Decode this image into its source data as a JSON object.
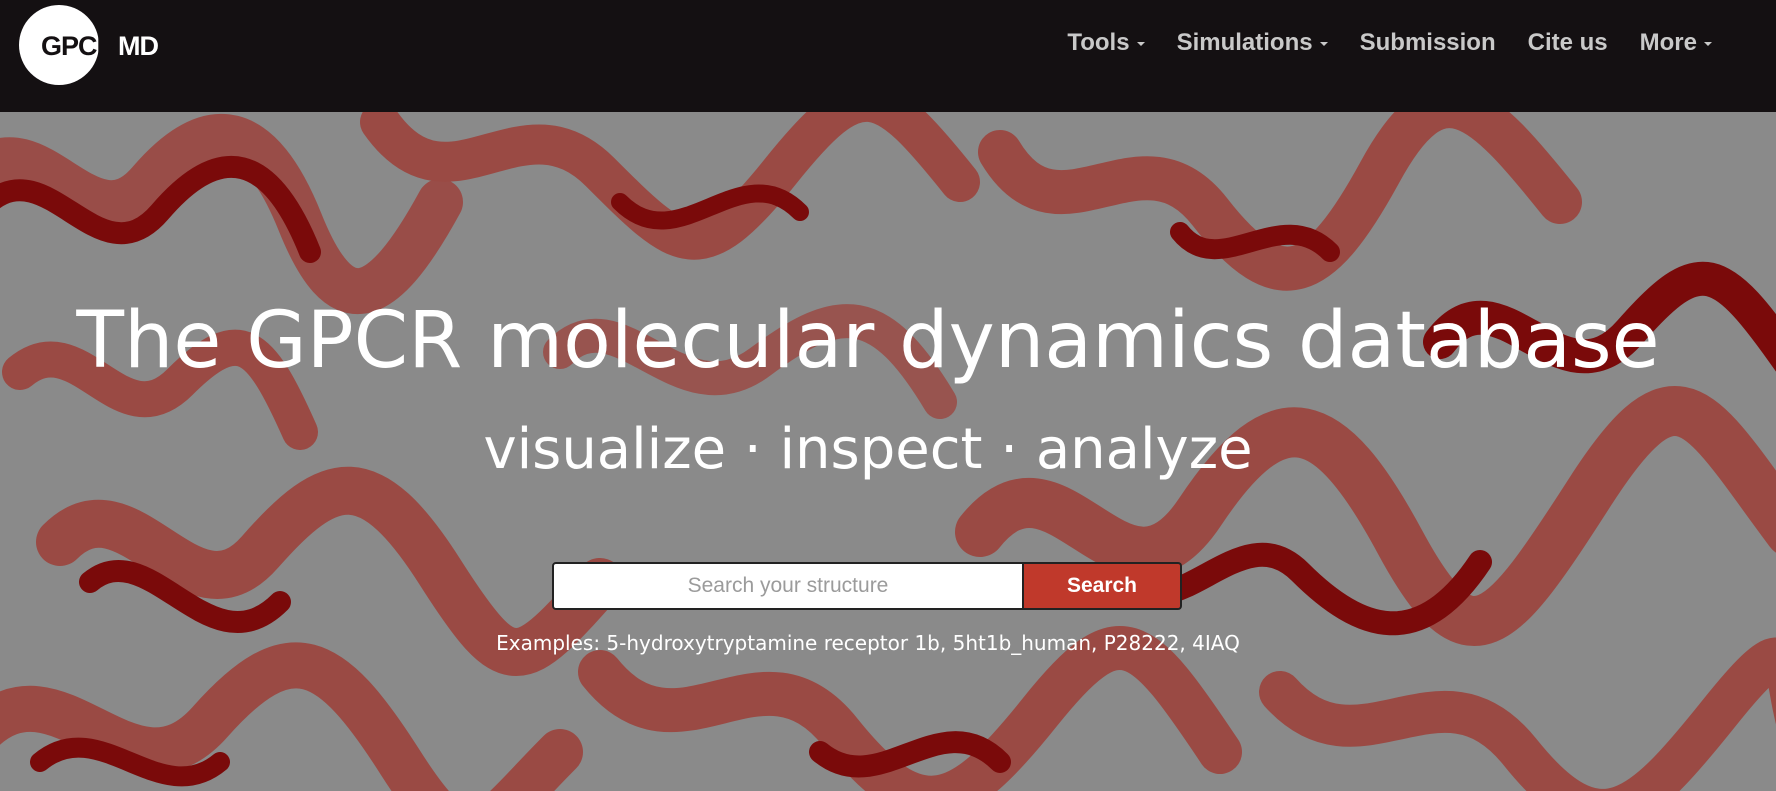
{
  "brand": {
    "logo_left": "GPCR",
    "logo_right": "MD",
    "colors": {
      "navbar_bg": "#141012",
      "nav_text": "#c9c9c9",
      "accent": "#c0392b",
      "hero_bg": "#8a8a8a",
      "helix_dark": "#7a0a0a",
      "helix_light": "#9a4a44"
    }
  },
  "nav": {
    "items": [
      {
        "label": "Tools",
        "dropdown": true
      },
      {
        "label": "Simulations",
        "dropdown": true
      },
      {
        "label": "Submission",
        "dropdown": false
      },
      {
        "label": "Cite us",
        "dropdown": false
      },
      {
        "label": "More",
        "dropdown": true
      }
    ]
  },
  "hero": {
    "title": "The GPCR molecular dynamics database",
    "subtitle": "visualize · inspect · analyze",
    "background": "protein-helix-ribbons-image"
  },
  "search": {
    "placeholder": "Search your structure",
    "value": "",
    "button_label": "Search"
  },
  "examples": {
    "text": "Examples: 5-hydroxytryptamine receptor 1b, 5ht1b_human, P28222, 4IAQ"
  }
}
